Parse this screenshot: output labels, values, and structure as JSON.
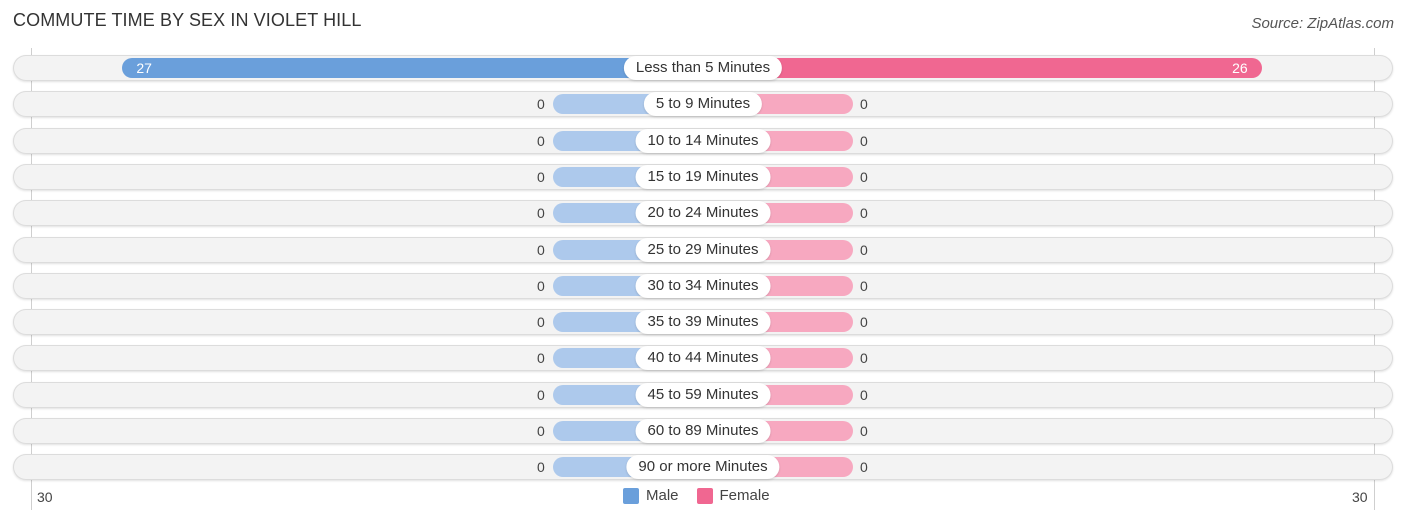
{
  "header": {
    "title": "COMMUTE TIME BY SEX IN VIOLET HILL",
    "source": "Source: ZipAtlas.com"
  },
  "colors": {
    "male": "#6a9fdb",
    "female": "#f06791",
    "male_zero": "#adc9ec",
    "female_zero": "#f7a8c0"
  },
  "chart_data": {
    "type": "bar",
    "orientation": "horizontal-diverging",
    "title": "COMMUTE TIME BY SEX IN VIOLET HILL",
    "categories": [
      "Less than 5 Minutes",
      "5 to 9 Minutes",
      "10 to 14 Minutes",
      "15 to 19 Minutes",
      "20 to 24 Minutes",
      "25 to 29 Minutes",
      "30 to 34 Minutes",
      "35 to 39 Minutes",
      "40 to 44 Minutes",
      "45 to 59 Minutes",
      "60 to 89 Minutes",
      "90 or more Minutes"
    ],
    "series": [
      {
        "name": "Male",
        "values": [
          27,
          0,
          0,
          0,
          0,
          0,
          0,
          0,
          0,
          0,
          0,
          0
        ]
      },
      {
        "name": "Female",
        "values": [
          26,
          0,
          0,
          0,
          0,
          0,
          0,
          0,
          0,
          0,
          0,
          0
        ]
      }
    ],
    "axis": {
      "min_label": "30",
      "max_label": "30",
      "range": [
        -30,
        30
      ]
    },
    "legend": {
      "position": "bottom-center",
      "entries": [
        "Male",
        "Female"
      ]
    },
    "grid": false
  }
}
